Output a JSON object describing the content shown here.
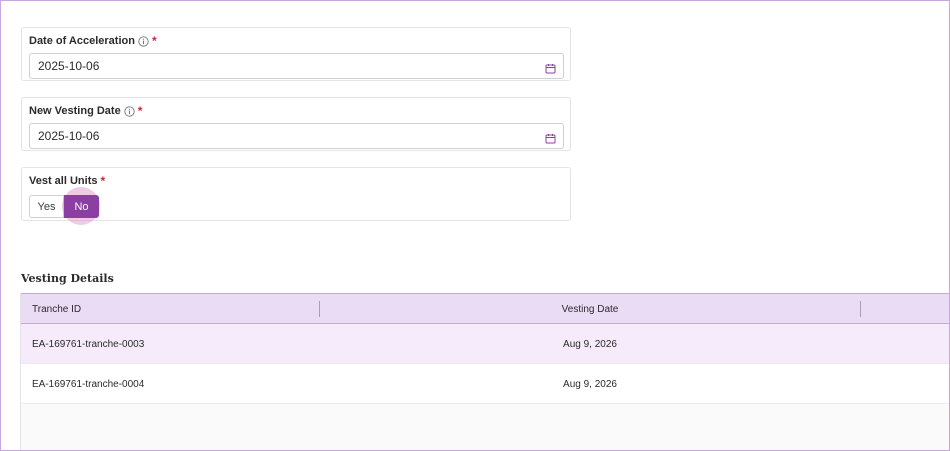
{
  "form": {
    "acceleration": {
      "label": "Date of Acceleration",
      "required_mark": "*",
      "value": "2025-10-06"
    },
    "new_vesting": {
      "label": "New Vesting Date",
      "required_mark": "*",
      "value": "2025-10-06"
    },
    "vest_all": {
      "label": "Vest all Units",
      "required_mark": "*",
      "options": [
        "Yes",
        "No"
      ],
      "selected": "No"
    }
  },
  "icons": {
    "info": "info-circle-icon",
    "calendar": "calendar-icon"
  },
  "colors": {
    "accent": "#8b3fa3",
    "header_bg": "#eadcf5",
    "highlight_row": "#f6ebfa",
    "required": "#d0243a"
  },
  "vesting": {
    "title": "Vesting Details",
    "columns": [
      "Tranche ID",
      "Vesting Date"
    ],
    "rows": [
      {
        "tranche_id": "EA-169761-tranche-0003",
        "vesting_date": "Aug 9, 2026"
      },
      {
        "tranche_id": "EA-169761-tranche-0004",
        "vesting_date": "Aug 9, 2026"
      }
    ]
  }
}
